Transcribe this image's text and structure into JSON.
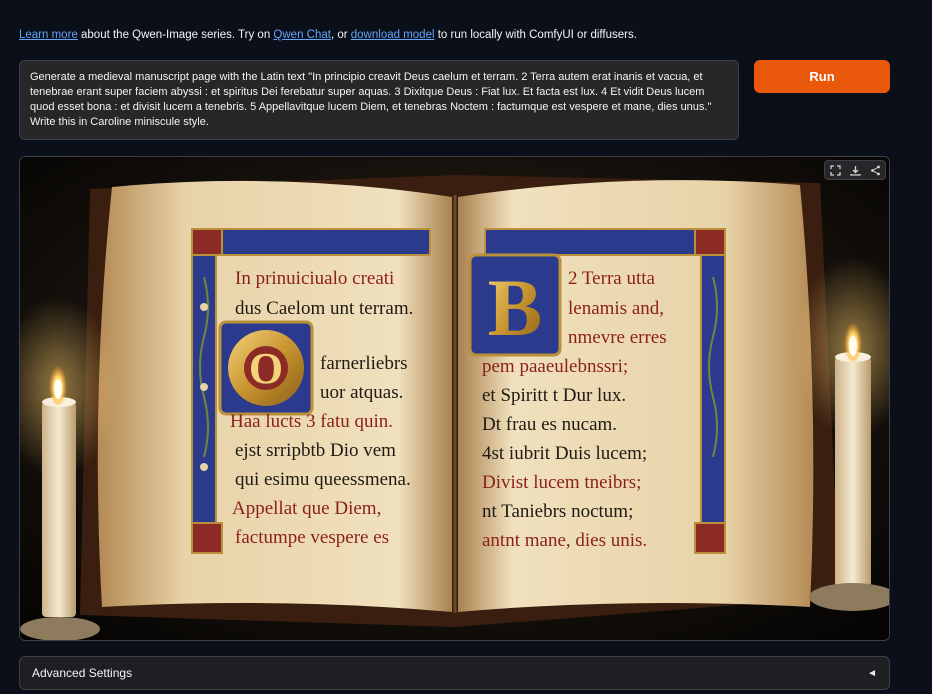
{
  "header": {
    "learn_more": "Learn more",
    "text_1": " about the Qwen-Image series. Try on ",
    "qwen_chat": "Qwen Chat",
    "text_2": ", or ",
    "download_model": "download model",
    "text_3": " to run locally with ComfyUI or diffusers."
  },
  "prompt": {
    "value": "Generate a medieval manuscript page with the Latin text \"In principio creavit Deus caelum et terram.  2 Terra autem erat inanis et vacua, et tenebrae erant super faciem abyssi : et spiritus Dei ferebatur super aquas.  3 Dixitque Deus : Fiat lux. Et facta est lux.  4 Et vidit Deus lucem quod esset bona : et divisit lucem a tenebris.  5 Appellavitque lucem Diem, et tenebras Noctem : factumque est vespere et mane, dies unus.\" Write this in Caroline miniscule style."
  },
  "run_button": {
    "label": "Run"
  },
  "image": {
    "left_page": [
      "In prinuiciualo creati",
      "dus Caelom unt terram.",
      "farnerliebrs",
      "uor atquas.",
      "Haa lucts 3 fatu quin.",
      "ejst srripbtb Dio vem",
      "qui esimu queessmena.",
      "Appellat que Diem,",
      "factumpe vespere es"
    ],
    "right_page": [
      "2 Terra utta",
      "lenamis and,",
      "nmevre erres",
      "pem paaeulebnssri;",
      "et Spiritt t Dur lux.",
      "Dt frau es nucam.",
      "4st iubrit Duis lucem;",
      "Divist lucem tneibrs;",
      "nt Taniebrs noctum;",
      "antnt mane, dies unis."
    ],
    "left_initial": "O",
    "right_initial": "B"
  },
  "toolbar": {
    "fullscreen_icon": "fullscreen-icon",
    "download_icon": "download-icon",
    "share_icon": "share-icon"
  },
  "advanced": {
    "label": "Advanced Settings",
    "arrow": "◄"
  },
  "colors": {
    "accent": "#ea580c",
    "link": "#60a5fa",
    "background": "#0b0f19"
  }
}
